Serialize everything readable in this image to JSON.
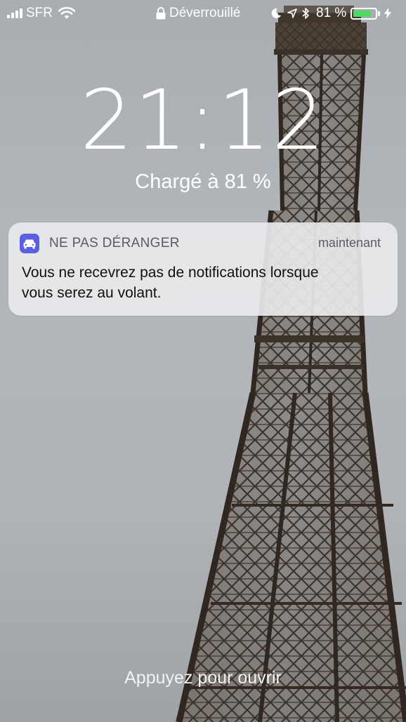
{
  "status_bar": {
    "carrier": "SFR",
    "lock_status": "Déverrouillé",
    "battery_percent": "81 %",
    "battery_level": 0.81,
    "icons": [
      "signal-icon",
      "wifi-icon",
      "lock-icon",
      "moon-icon",
      "location-icon",
      "bluetooth-icon",
      "battery-icon",
      "charging-icon"
    ],
    "battery_color": "#4cd964"
  },
  "lock_screen": {
    "time": "21:12",
    "charge_status": "Chargé à 81 %",
    "unlock_hint": "Appuyez pour ouvrir"
  },
  "notification": {
    "app_icon": "car-icon",
    "app_icon_color": "#5b5fe0",
    "app_name": "NE PAS DÉRANGER",
    "time": "maintenant",
    "line1": "Vous ne recevrez pas de notifications lorsque",
    "line2": "vous serez au volant."
  }
}
